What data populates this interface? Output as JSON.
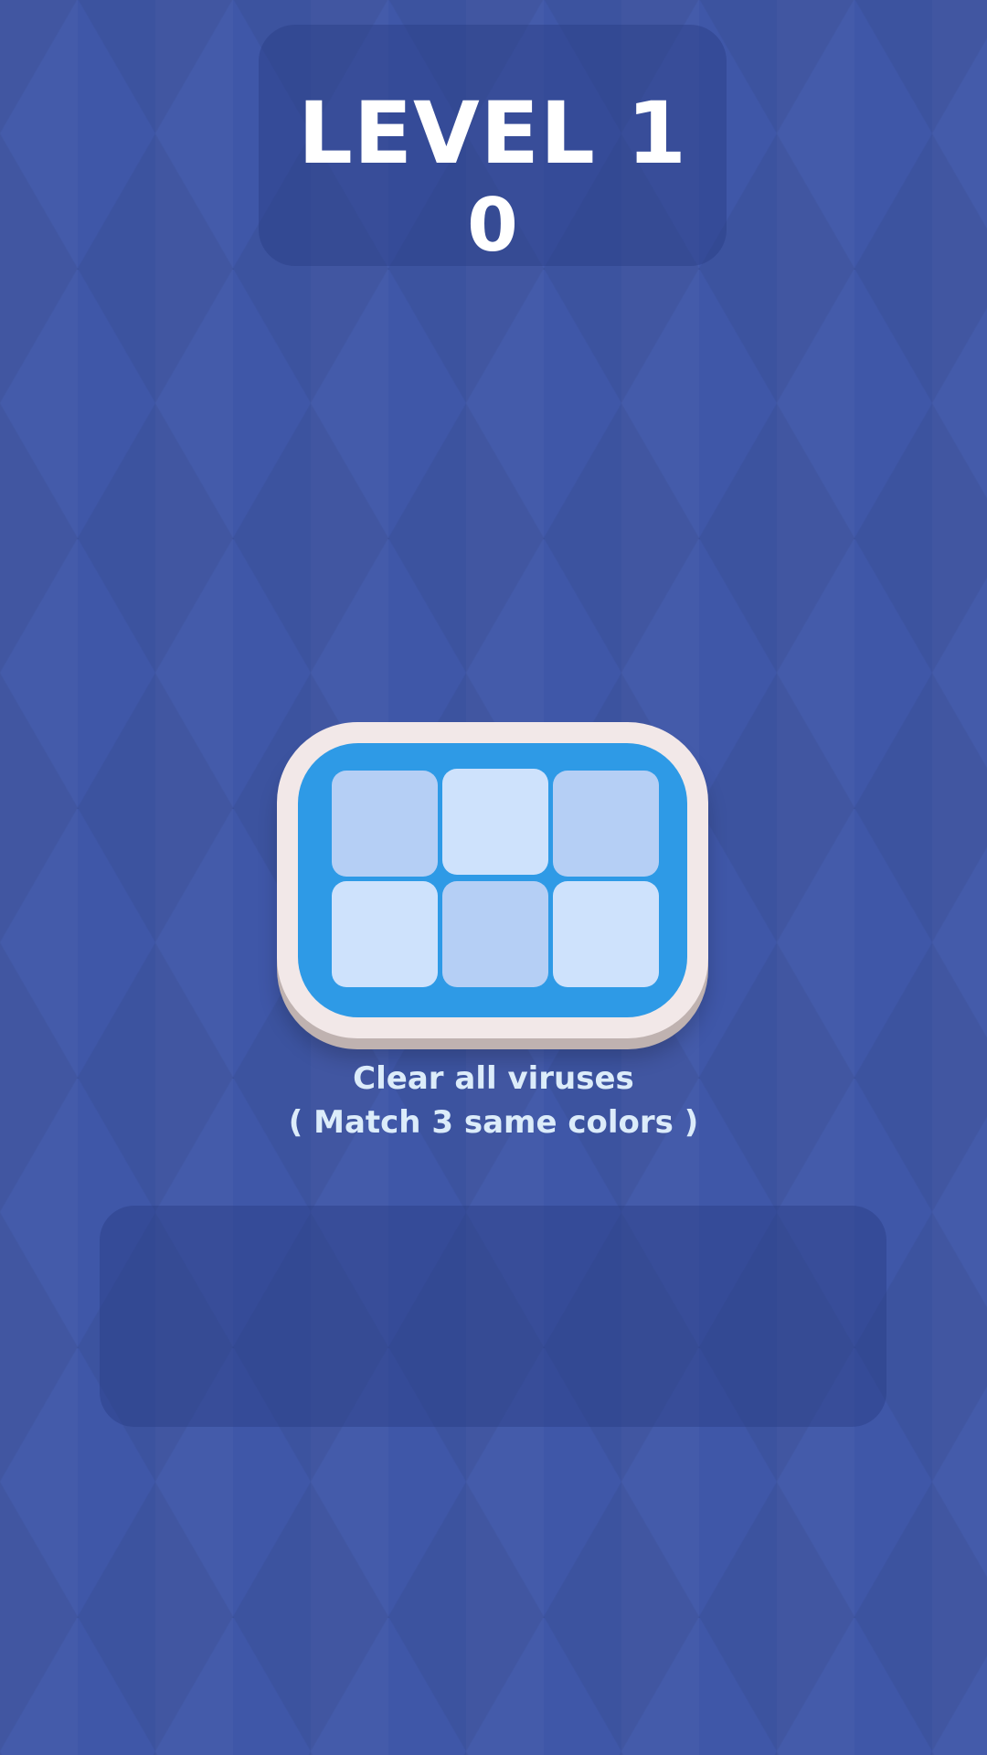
{
  "header": {
    "level_label": "LEVEL 1",
    "score": "0"
  },
  "tray": {
    "rows": 2,
    "cols": 3,
    "cells": [
      {
        "shade": "light-blue",
        "filled": false
      },
      {
        "shade": "pale-blue",
        "filled": false
      },
      {
        "shade": "light-blue",
        "filled": false
      },
      {
        "shade": "pale-blue",
        "filled": false
      },
      {
        "shade": "light-blue",
        "filled": false
      },
      {
        "shade": "pale-blue",
        "filled": false
      }
    ]
  },
  "instructions": {
    "line1": "Clear all viruses",
    "line2": "( Match 3 same colors )"
  },
  "colors": {
    "background": "#3f57a8",
    "tray_frame": "#f2e8e8",
    "tray_inner": "#2e9ae6",
    "cell_light_blue": "#b5cff5",
    "cell_pale_blue": "#cee2fc",
    "instruction_text": "#dcecfa"
  }
}
